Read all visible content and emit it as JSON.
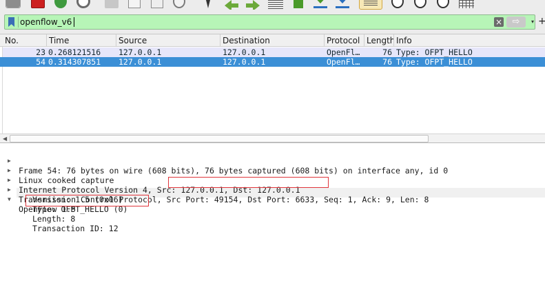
{
  "filter": {
    "value": "openflow_v6",
    "clear_icon": "×",
    "apply_icon": "⇨",
    "dropdown_icon": "▾",
    "add_icon": "+"
  },
  "packet_list": {
    "columns": [
      "No.",
      "Time",
      "Source",
      "Destination",
      "Protocol",
      "Length",
      "Info"
    ],
    "rows": [
      {
        "no": "23",
        "time": "0.268121516",
        "source": "127.0.0.1",
        "destination": "127.0.0.1",
        "protocol": "OpenFl…",
        "length": "76",
        "info": "Type: OFPT_HELLO",
        "selected": false
      },
      {
        "no": "54",
        "time": "0.314307851",
        "source": "127.0.0.1",
        "destination": "127.0.0.1",
        "protocol": "OpenFl…",
        "length": "76",
        "info": "Type: OFPT_HELLO",
        "selected": true
      }
    ]
  },
  "scrollbar": {
    "left_arrow": "◀"
  },
  "details": {
    "collapsed_arrow": "▶",
    "expanded_arrow": "▼",
    "frame": "Frame 54: 76 bytes on wire (608 bits), 76 bytes captured (608 bits) on interface any, id 0",
    "linux": "Linux cooked capture",
    "ip": "Internet Protocol Version 4, Src: 127.0.0.1, Dst: 127.0.0.1",
    "tcp": "Transmission Control Protocol, Src Port: 49154, Dst Port: 6633, Seq: 1, Ack: 9, Len: 8",
    "openflow": "OpenFlow 1.5",
    "version": "Version: 1.5 (0x06)",
    "type": "Type: OFPT_HELLO (0)",
    "length": "Length: 8",
    "xid": "Transaction ID: 12"
  },
  "colors": {
    "filter_valid": "#b7f5b7",
    "row_normal": "#e6e6fa",
    "row_selected": "#3b8fd6",
    "highlight": "#e0343a"
  }
}
